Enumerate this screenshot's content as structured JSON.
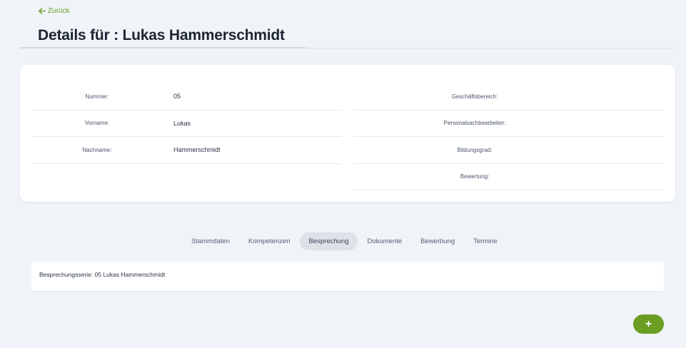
{
  "header": {
    "back_label": "Zurück",
    "title": "Details für : Lukas Hammerschmidt"
  },
  "details": {
    "left": [
      {
        "label": "Nummer:",
        "value": "05"
      },
      {
        "label": "Vorname:",
        "value": "Lukas"
      },
      {
        "label": "Nachname:",
        "value": "Hammerschmidt"
      }
    ],
    "right": [
      {
        "label": "Geschäftsbereich:",
        "value": ""
      },
      {
        "label": "Personalsachbearbeiter:",
        "value": ""
      },
      {
        "label": "Bildungsgrad:",
        "value": ""
      },
      {
        "label": "Bewertung:",
        "value": ""
      }
    ]
  },
  "tabs": [
    {
      "label": "Stammdaten",
      "active": false
    },
    {
      "label": "Kompetenzen",
      "active": false
    },
    {
      "label": "Besprechung",
      "active": true
    },
    {
      "label": "Dokumente",
      "active": false
    },
    {
      "label": "Bewerbung",
      "active": false
    },
    {
      "label": "Termine",
      "active": false
    }
  ],
  "panel": {
    "text": "Besprechungsserie: 05 Lukas Hammerschmidt"
  },
  "fab": {
    "label": "+"
  },
  "colors": {
    "accent": "#6a9d22",
    "background": "#f0f3f8",
    "card": "#ffffff"
  }
}
